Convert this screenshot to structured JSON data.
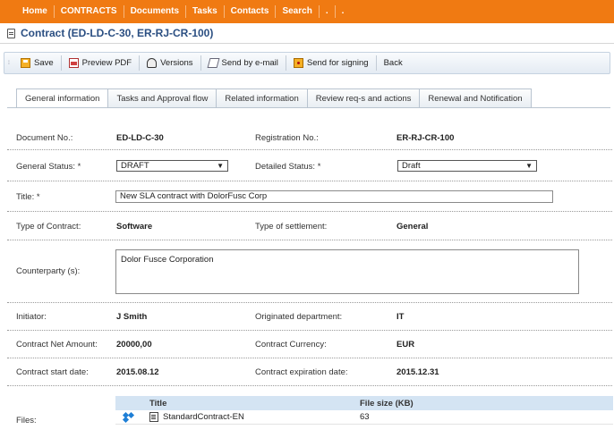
{
  "nav": {
    "items": [
      "Home",
      "CONTRACTS",
      "Documents",
      "Tasks",
      "Contacts",
      "Search",
      ".",
      "."
    ]
  },
  "page": {
    "title": "Contract (ED-LD-C-30, ER-RJ-CR-100)"
  },
  "toolbar": {
    "save": "Save",
    "preview_pdf": "Preview PDF",
    "versions": "Versions",
    "send_email": "Send by e-mail",
    "send_signing": "Send for signing",
    "back": "Back"
  },
  "tabs": [
    {
      "label": "General information",
      "active": true
    },
    {
      "label": "Tasks and Approval flow",
      "active": false
    },
    {
      "label": "Related information",
      "active": false
    },
    {
      "label": "Review req-s and actions",
      "active": false
    },
    {
      "label": "Renewal and Notification",
      "active": false
    }
  ],
  "form": {
    "document_no_label": "Document No.:",
    "document_no": "ED-LD-C-30",
    "registration_no_label": "Registration No.:",
    "registration_no": "ER-RJ-CR-100",
    "general_status_label": "General Status:  *",
    "general_status": "DRAFT",
    "detailed_status_label": "Detailed Status:  *",
    "detailed_status": "Draft",
    "title_label": "Title:  *",
    "title_value": "New SLA contract with DolorFusc Corp",
    "type_label": "Type of Contract:",
    "type_value": "Software",
    "settlement_label": "Type of settlement:",
    "settlement_value": "General",
    "counterparty_label": "Counterparty (s):",
    "counterparty_value": "Dolor Fusce Corporation",
    "initiator_label": "Initiator:",
    "initiator_value": "J Smith",
    "department_label": "Originated department:",
    "department_value": "IT",
    "amount_label": "Contract Net Amount:",
    "amount_value": "20000,00",
    "currency_label": "Contract Currency:",
    "currency_value": "EUR",
    "start_label": "Contract start date:",
    "start_value": "2015.08.12",
    "expiration_label": "Contract expiration date:",
    "expiration_value": "2015.12.31",
    "files_label": "Files:"
  },
  "files": {
    "col_title": "Title",
    "col_size": "File size (KB)",
    "rows": [
      {
        "title": "StandardContract-EN",
        "size": "63"
      }
    ]
  },
  "colors": {
    "nav_bg": "#f07a12",
    "title_text": "#2b4f82",
    "table_header_bg": "#d4e4f3"
  }
}
